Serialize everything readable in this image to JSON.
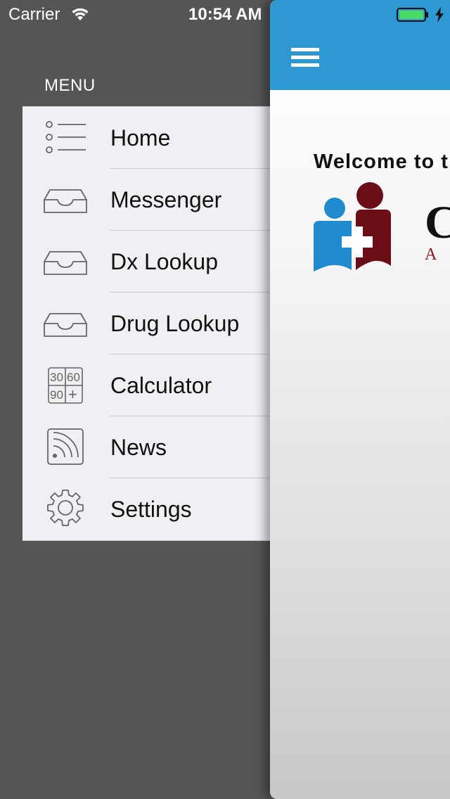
{
  "status_bar": {
    "carrier": "Carrier",
    "time": "10:54 AM"
  },
  "menu": {
    "title": "MENU",
    "items": [
      {
        "label": "Home",
        "icon": "list-icon"
      },
      {
        "label": "Messenger",
        "icon": "inbox-tray-icon"
      },
      {
        "label": "Dx Lookup",
        "icon": "inbox-tray-icon"
      },
      {
        "label": "Drug Lookup",
        "icon": "inbox-tray-icon"
      },
      {
        "label": "Calculator",
        "icon": "calculator-icon"
      },
      {
        "label": "News",
        "icon": "rss-feed-icon"
      },
      {
        "label": "Settings",
        "icon": "gear-icon"
      }
    ],
    "calculator_icon_text": [
      "30",
      "60",
      "90",
      "+"
    ]
  },
  "main": {
    "welcome_text": "Welcome to t",
    "logo_letters": {
      "big": "C",
      "small": "A S"
    }
  },
  "colors": {
    "nav_bar": "#2e98d3",
    "drawer_bg": "#555555",
    "menu_bg": "#efeff4",
    "logo_blue": "#1f8ad0",
    "logo_maroon": "#6b0d16",
    "battery_fill": "#4cd964"
  }
}
